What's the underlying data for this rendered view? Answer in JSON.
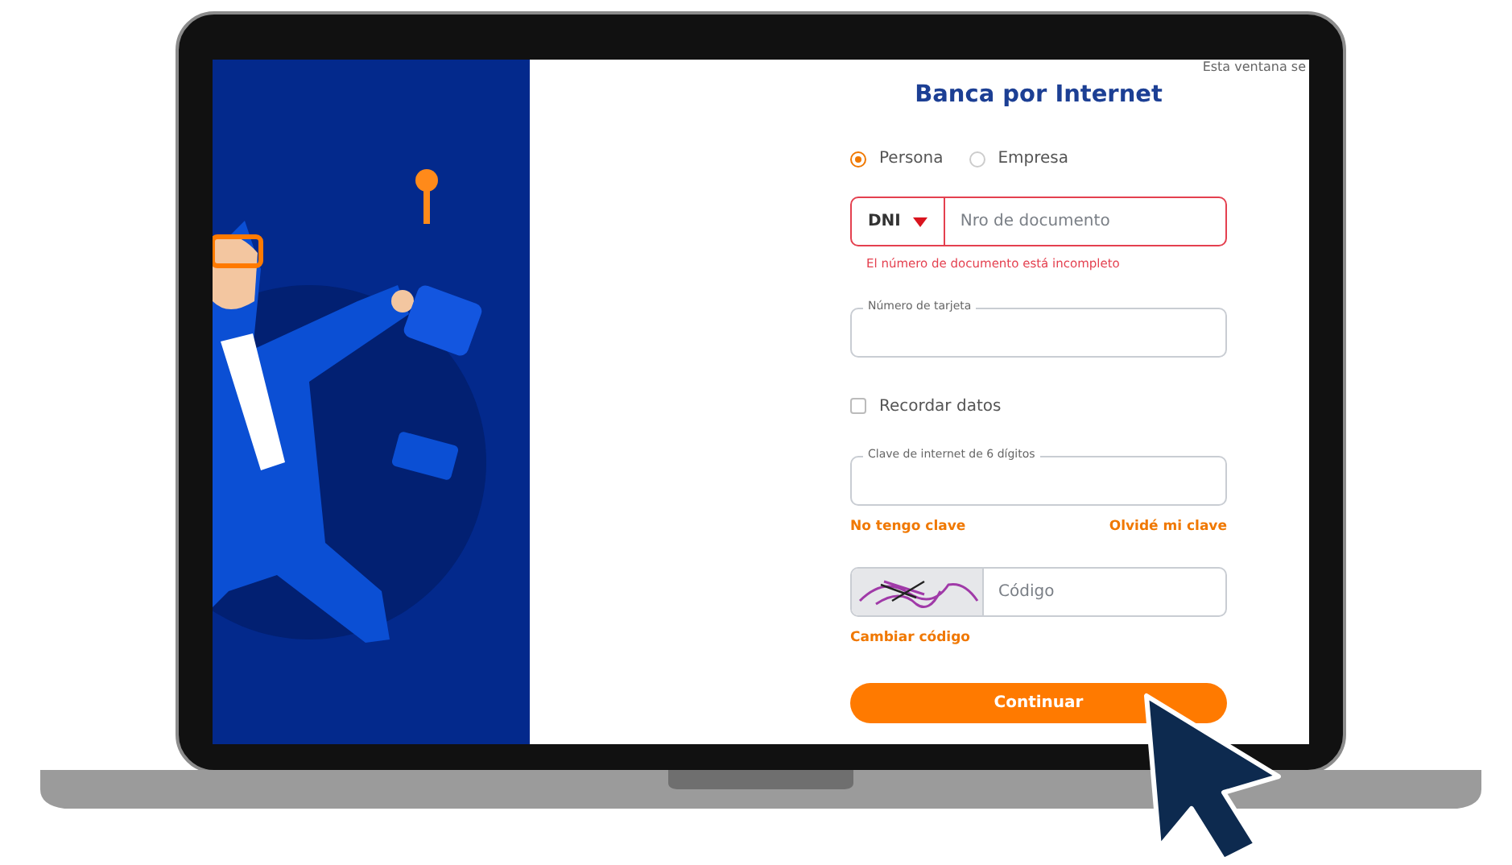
{
  "notice": "Esta ventana se",
  "title": "Banca por Internet",
  "client_types": [
    {
      "label": "Persona",
      "selected": true
    },
    {
      "label": "Empresa",
      "selected": false
    }
  ],
  "document": {
    "type": "DNI",
    "placeholder": "Nro de documento",
    "invalid": true,
    "error": "El número de documento está incompleto"
  },
  "card_field": {
    "label": "Número de tarjeta"
  },
  "remember": {
    "label": "Recordar datos",
    "checked": false
  },
  "password_field": {
    "label": "Clave de internet de 6 dígitos"
  },
  "password_links": [
    "No tengo clave",
    "Olvidé mi clave"
  ],
  "captcha": {
    "placeholder": "Código",
    "change_link": "Cambiar código"
  },
  "submit": "Continuar"
}
